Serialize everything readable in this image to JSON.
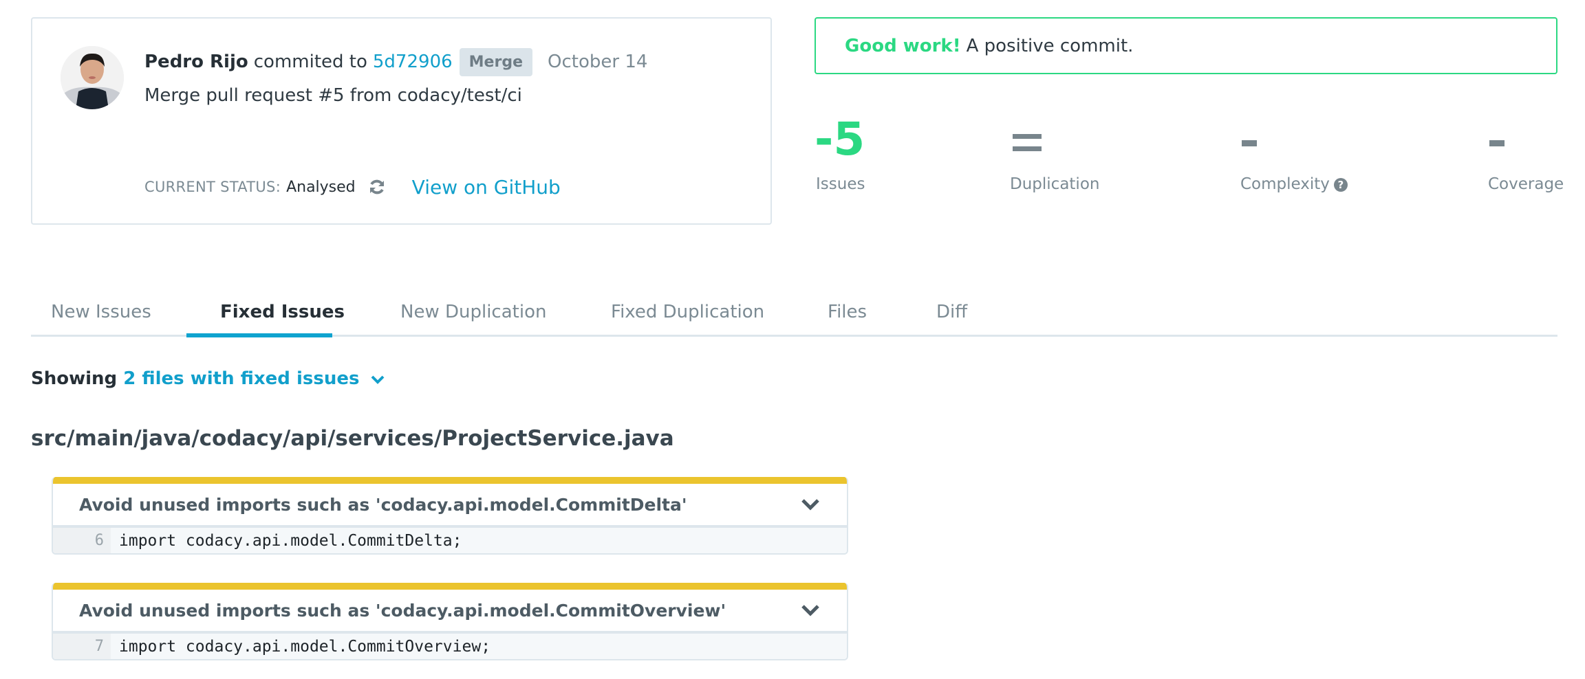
{
  "commit": {
    "author": "Pedro Rijo",
    "action": "commited to",
    "hash": "5d72906",
    "badge": "Merge",
    "date": "October 14",
    "message": "Merge pull request #5 from codacy/test/ci",
    "status_label": "CURRENT STATUS:",
    "status_value": "Analysed",
    "github_link": "View on GitHub"
  },
  "banner": {
    "strong": "Good work!",
    "text": "A positive commit."
  },
  "stats": [
    {
      "value": "-5",
      "label": "Issues",
      "color": "#2bd882"
    },
    {
      "value": "=",
      "label": "Duplication",
      "color": "#78858c"
    },
    {
      "value": "-",
      "label": "Complexity",
      "help": "?",
      "color": "#78858c"
    },
    {
      "value": "-",
      "label": "Coverage",
      "color": "#78858c"
    }
  ],
  "tabs": [
    {
      "label": "New Issues",
      "active": false
    },
    {
      "label": "Fixed Issues",
      "active": true
    },
    {
      "label": "New Duplication",
      "active": false
    },
    {
      "label": "Fixed Duplication",
      "active": false
    },
    {
      "label": "Files",
      "active": false
    },
    {
      "label": "Diff",
      "active": false
    }
  ],
  "showing": {
    "prefix": "Showing",
    "link": "2 files with fixed issues"
  },
  "file": {
    "path": "src/main/java/codacy/api/services/ProjectService.java",
    "issues": [
      {
        "title": "Avoid unused imports such as 'codacy.api.model.CommitDelta'",
        "line": "6",
        "code": "import codacy.api.model.CommitDelta;"
      },
      {
        "title": "Avoid unused imports such as 'codacy.api.model.CommitOverview'",
        "line": "7",
        "code": "import codacy.api.model.CommitOverview;"
      }
    ]
  },
  "colors": {
    "accent": "#119fcb",
    "positive": "#2bd882",
    "warning": "#ebc42e"
  }
}
